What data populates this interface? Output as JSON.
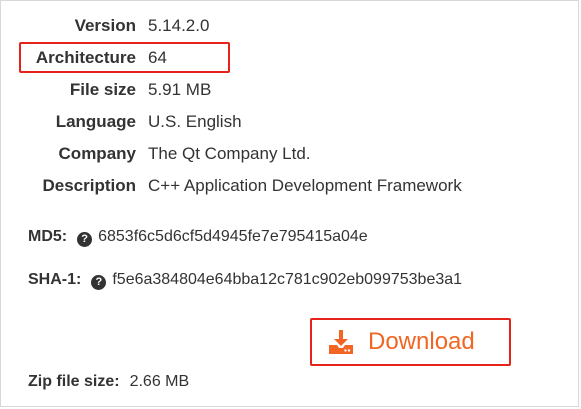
{
  "details": [
    {
      "label": "Version",
      "value": "5.14.2.0"
    },
    {
      "label": "Architecture",
      "value": "64"
    },
    {
      "label": "File size",
      "value": "5.91 MB"
    },
    {
      "label": "Language",
      "value": "U.S. English"
    },
    {
      "label": "Company",
      "value": "The Qt Company Ltd."
    },
    {
      "label": "Description",
      "value": "C++ Application Development Framework"
    }
  ],
  "hashes": {
    "md5": {
      "label": "MD5:",
      "value": "6853f6c5d6cf5d4945fe7e795415a04e",
      "help_icon": "question-circle-icon"
    },
    "sha1": {
      "label": "SHA-1:",
      "value": "f5e6a384804e64bba12c781c902eb099753be3a1",
      "help_icon": "question-circle-icon"
    }
  },
  "download": {
    "label": "Download",
    "icon": "download-tray-icon",
    "color": "#f26522"
  },
  "zip": {
    "label": "Zip file size:",
    "value": "2.66 MB"
  },
  "colors": {
    "highlight": "#e5231b",
    "accent": "#f26522",
    "text": "#333333"
  }
}
